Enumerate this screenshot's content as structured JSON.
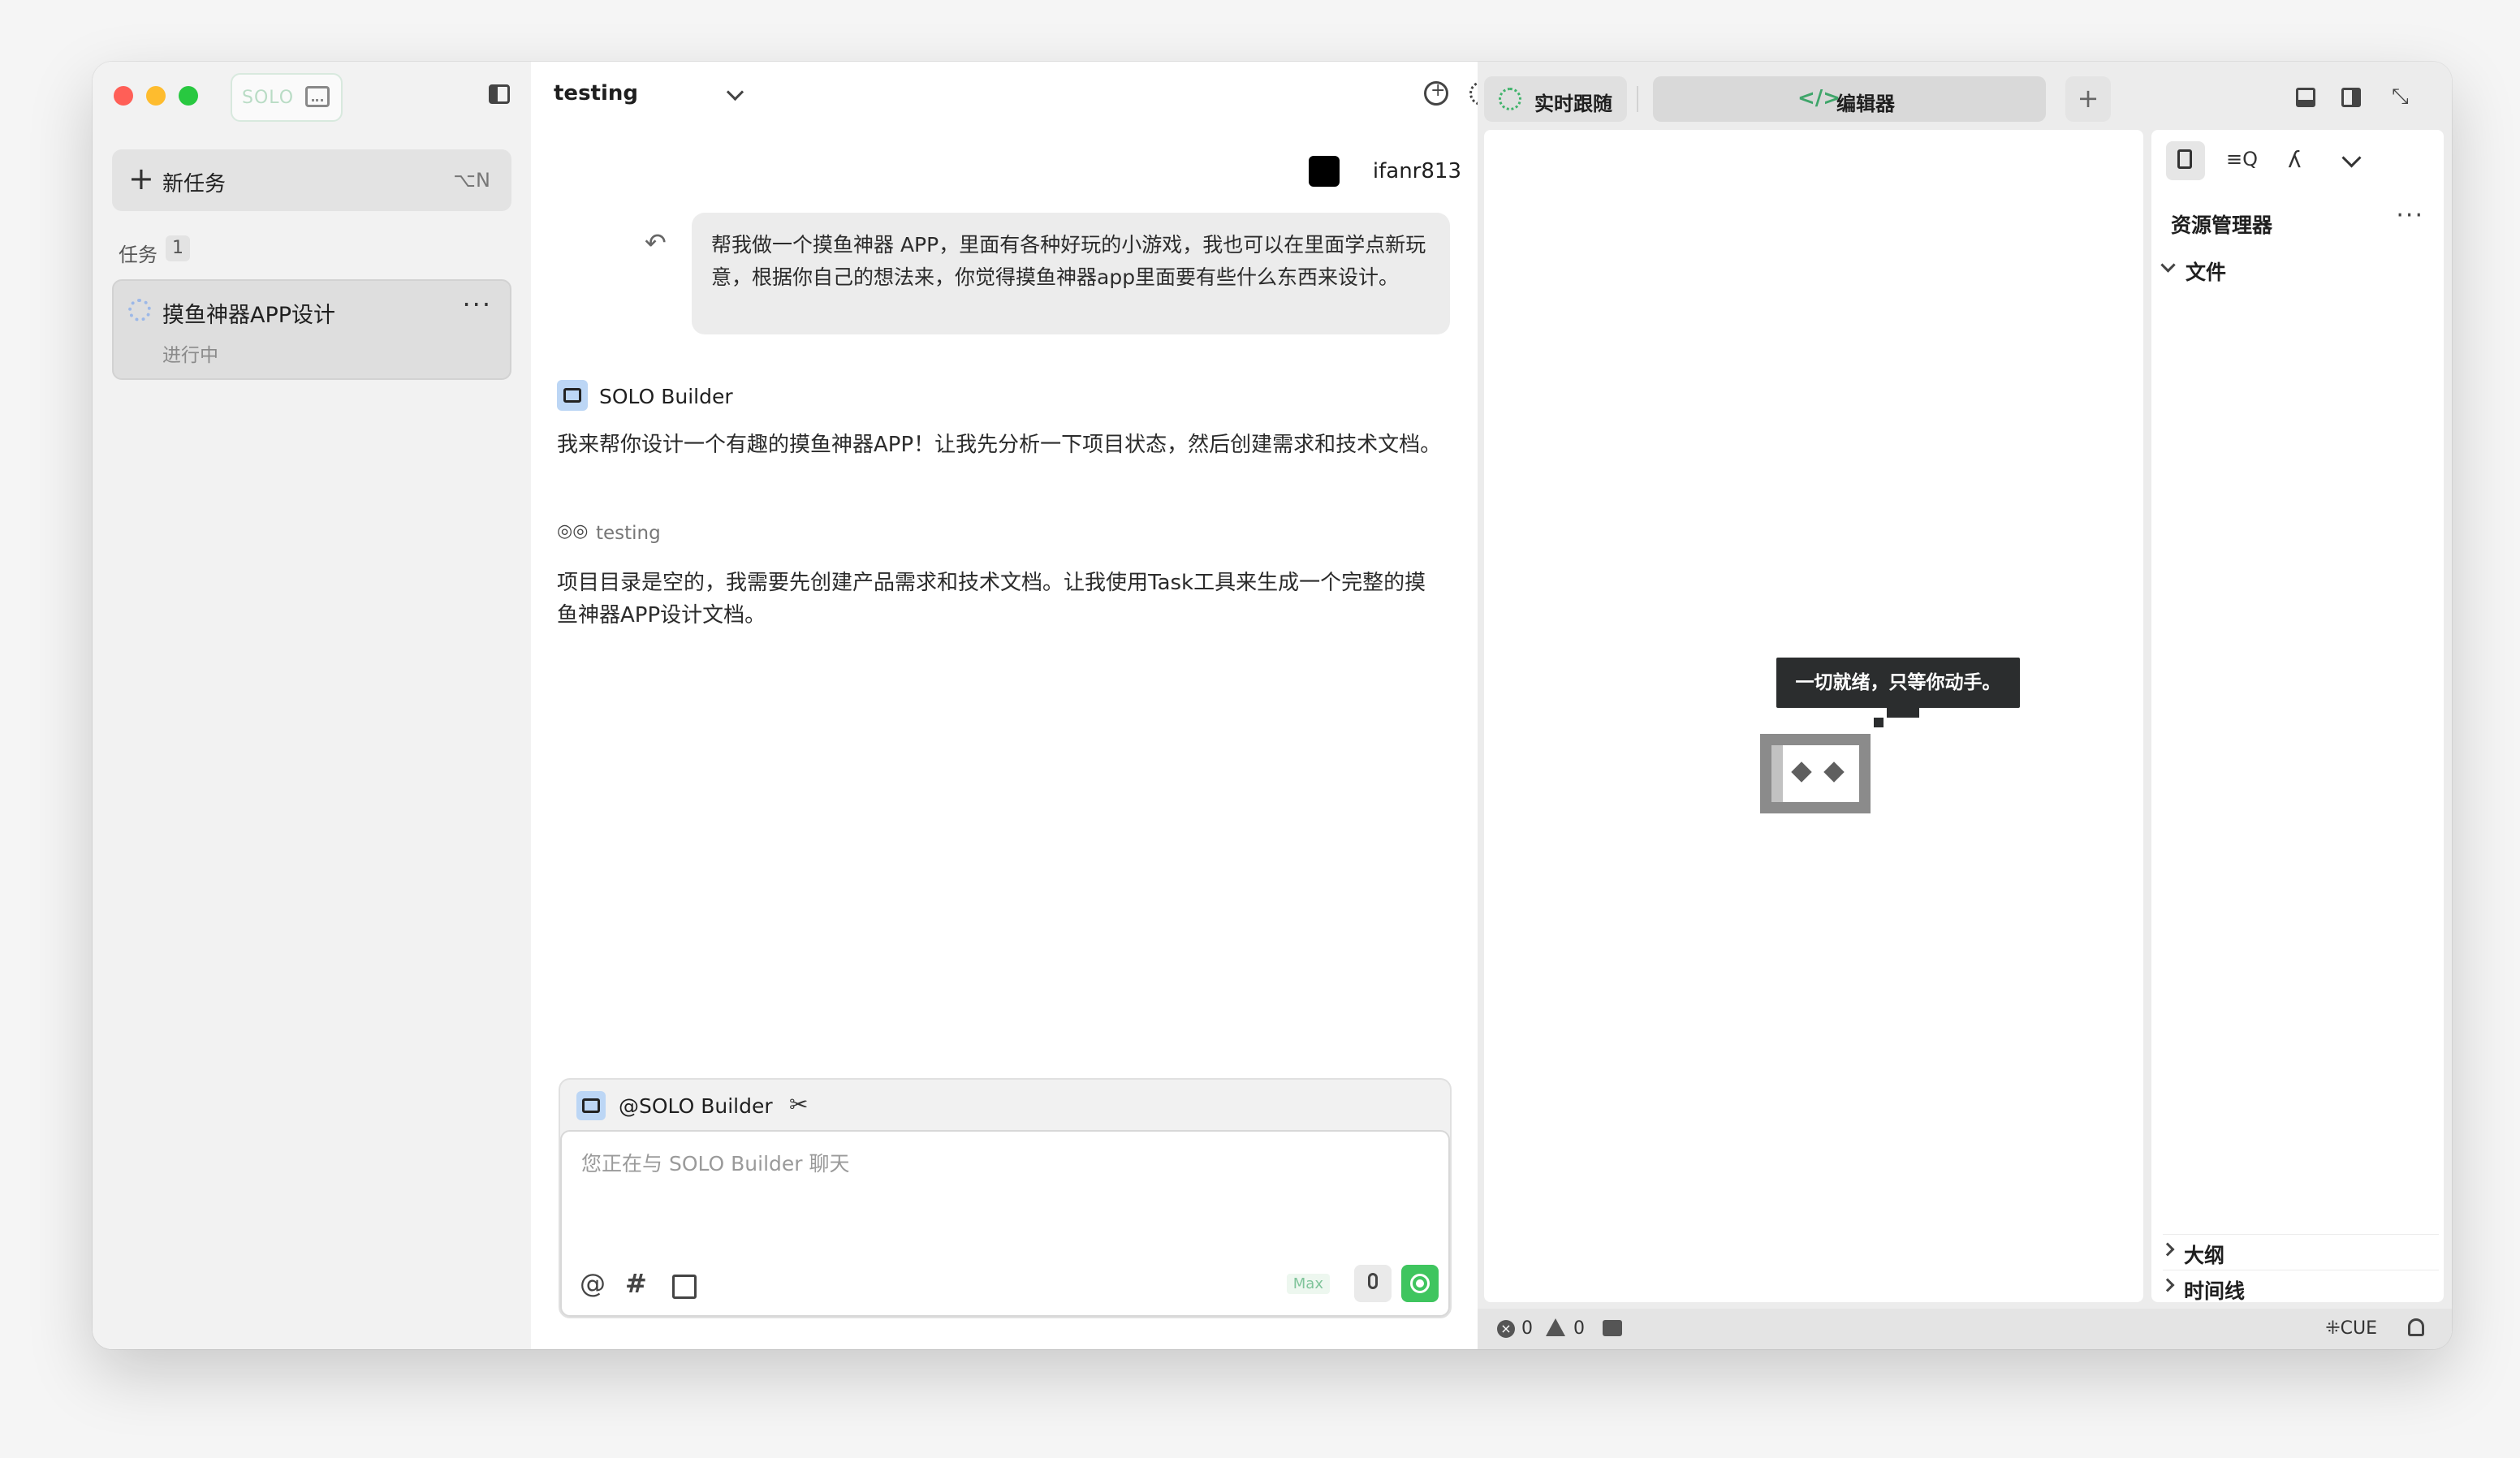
{
  "sidebar": {
    "brand_label": "SOLO",
    "new_task_label": "新任务",
    "new_task_shortcut": "⌥N",
    "tasks_header": "任务",
    "tasks_count": "1",
    "tasks": [
      {
        "title": "摸鱼神器APP设计",
        "status": "进行中"
      }
    ]
  },
  "chat": {
    "title": "testing",
    "user_name": "ifanr813",
    "user_message": "帮我做一个摸鱼神器 APP，里面有各种好玩的小游戏，我也可以在里面学点新玩意，根据你自己的想法来，你觉得摸鱼神器app里面要有些什么东西来设计。",
    "bot_name": "SOLO Builder",
    "bot_message_1": "我来帮你设计一个有趣的摸鱼神器APP！让我先分析一下项目状态，然后创建需求和技术文档。",
    "thinking_label": "testing",
    "bot_message_2": "项目目录是空的，我需要先创建产品需求和技术文档。让我使用Task工具来生成一个完整的摸鱼神器APP设计文档。",
    "composer": {
      "mention": "@SOLO Builder",
      "placeholder": "您正在与 SOLO Builder 聊天",
      "mode_badge": "Max"
    }
  },
  "panel": {
    "tabs": [
      {
        "label": "实时跟随"
      },
      {
        "label": "编辑器"
      }
    ],
    "preview_message": "一切就绪，只等你动手。",
    "explorer": {
      "title": "资源管理器",
      "files_label": "文件",
      "outline_label": "大纲",
      "timeline_label": "时间线"
    },
    "status": {
      "errors": "0",
      "warnings": "0",
      "lang": "CUE"
    }
  },
  "colors": {
    "accent_green": "#3fc55f",
    "tooltip_bg": "#2b2d2e",
    "bot_logo": "#bcd6f5"
  }
}
